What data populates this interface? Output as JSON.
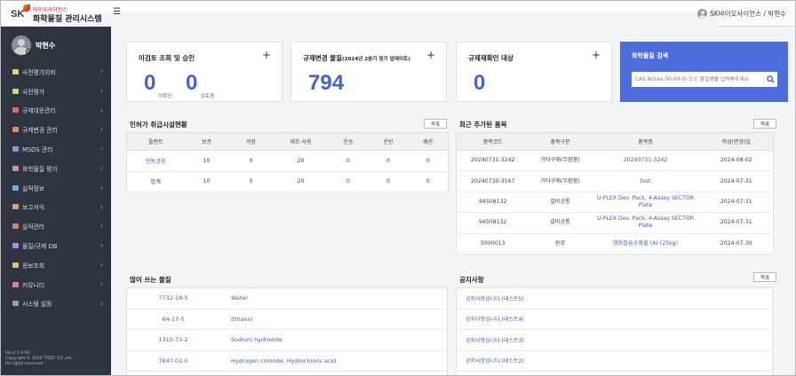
{
  "brand": {
    "sk": "SK",
    "subtitle": "바이오사이언스",
    "title": "화학물질 관리시스템"
  },
  "header": {
    "menu_icon": "hamburger-icon",
    "user_label": "SK바이오사이언스 / 박현수"
  },
  "sidebar": {
    "user_name": "박현수",
    "items": [
      {
        "label": "사전평가의뢰",
        "color": "#e8d06a"
      },
      {
        "label": "사전평가",
        "color": "#c9d96a"
      },
      {
        "label": "규제대응관리",
        "color": "#e06a6a"
      },
      {
        "label": "규제변경 관리",
        "color": "#e08a6a"
      },
      {
        "label": "MSDS 관리",
        "color": "#8a9ad0"
      },
      {
        "label": "화학물질 평가",
        "color": "#d08ac0"
      },
      {
        "label": "실적정보",
        "color": "#6ab0e0"
      },
      {
        "label": "보고서식",
        "color": "#e0a06a"
      },
      {
        "label": "실적관리",
        "color": "#e07a6a"
      },
      {
        "label": "물질/규제 DB",
        "color": "#b08ae0"
      },
      {
        "label": "정보조회",
        "color": "#e0c06a"
      },
      {
        "label": "커뮤니티",
        "color": "#e07ab0"
      },
      {
        "label": "시스템 설정",
        "color": "#9aa0ab"
      }
    ],
    "footer": [
      "Ver.2.1.0-RC",
      "Copyright © 2016 TOZO CO.,Ltd.",
      "All rights reserved."
    ]
  },
  "cards": {
    "review": {
      "title": "미검토 조회 및 승인",
      "num1": "0",
      "label1": "미확인",
      "num2": "0",
      "label2": "검토중"
    },
    "reg_change": {
      "title": "규제변경 물질",
      "title_note": "(2024년 2분기 정기 업데이트)",
      "num": "794"
    },
    "reg_recheck": {
      "title": "규제재확인 대상",
      "num": "0"
    },
    "search": {
      "title": "화학물질 검색",
      "placeholder": "CAS NO(ex 00-00-0) 또는 물질명을 입력해주세요"
    }
  },
  "facility": {
    "title": "인허가 취급시설현황",
    "more": "목록",
    "columns": [
      "플랜트",
      "보관",
      "저장",
      "제조·사용",
      "운송",
      "운반",
      "배관"
    ],
    "rows": [
      [
        "안동공장",
        "10",
        "0",
        "20",
        "0",
        "0",
        "0"
      ],
      [
        "합계",
        "10",
        "0",
        "20",
        "0",
        "0",
        "0"
      ]
    ]
  },
  "recent": {
    "title": "최근 추가된 품목",
    "more": "목록",
    "columns": [
      "품목코드",
      "품목구분",
      "품목명",
      "작성(변경)일"
    ],
    "rows": [
      [
        "20240731-3242",
        "기타구매(무환품)",
        "20240731-3242",
        "2024-08-02"
      ],
      [
        "20240730-3167",
        "기타구매(무환품)",
        "test",
        "2024-07-31"
      ],
      [
        "94508132",
        "설비공통",
        "U-PLEX Dev. Pack, 4-Assay SECTOR Plate",
        "2024-07-31"
      ],
      [
        "94508132",
        "설비공통",
        "U-PLEX Dev. Pack, 4-Assay SECTOR Plate",
        "2024-07-31"
      ],
      [
        "5000013",
        "원료",
        "염화칼슘수화물 (A) (25kg)",
        "2024-07-30"
      ]
    ]
  },
  "common": {
    "title": "많이 쓰는 물질",
    "rows": [
      {
        "cas": "7732-18-5",
        "name": "Water"
      },
      {
        "cas": "64-17-5",
        "name": "Ethanol"
      },
      {
        "cas": "1310-73-2",
        "name": "Sodium hydroxide"
      },
      {
        "cas": "7647-01-0",
        "name": "Hydrogen chloride, Hydrochloric acid"
      }
    ]
  },
  "notice": {
    "title": "공지사항",
    "more": "목록",
    "rows": [
      "공지사항입니다.(테스트5)",
      "공지사항입니다.(테스트4)",
      "공지사항입니다.(테스트3)",
      "공지사항입니다.(테스트2)"
    ]
  }
}
